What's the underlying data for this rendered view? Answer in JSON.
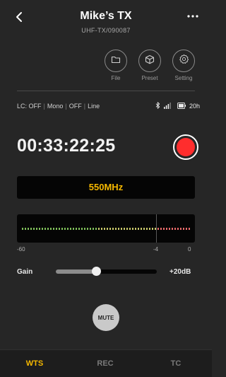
{
  "header": {
    "title": "Mike’s TX",
    "subtitle": "UHF-TX/090087"
  },
  "tools": [
    {
      "label": "File",
      "icon": "folder-icon"
    },
    {
      "label": "Preset",
      "icon": "cube-icon"
    },
    {
      "label": "Setting",
      "icon": "gear-icon"
    }
  ],
  "status": {
    "lc": "LC: OFF",
    "mono": "Mono",
    "mono_state": "OFF",
    "line": "Line",
    "battery": "20h"
  },
  "timecode": "00:33:22:25",
  "frequency": "550MHz",
  "meter": {
    "min_label": "-60",
    "mid_label": "-4",
    "max_label": "0"
  },
  "gain": {
    "label": "Gain",
    "value": "+20dB",
    "slider_fraction": 0.4
  },
  "mute_label": "MUTE",
  "tabs": [
    {
      "label": "WTS",
      "active": true
    },
    {
      "label": "REC",
      "active": false
    },
    {
      "label": "TC",
      "active": false
    }
  ],
  "colors": {
    "accent": "#f5b800",
    "record": "#ff2d2d",
    "background": "#262626"
  }
}
